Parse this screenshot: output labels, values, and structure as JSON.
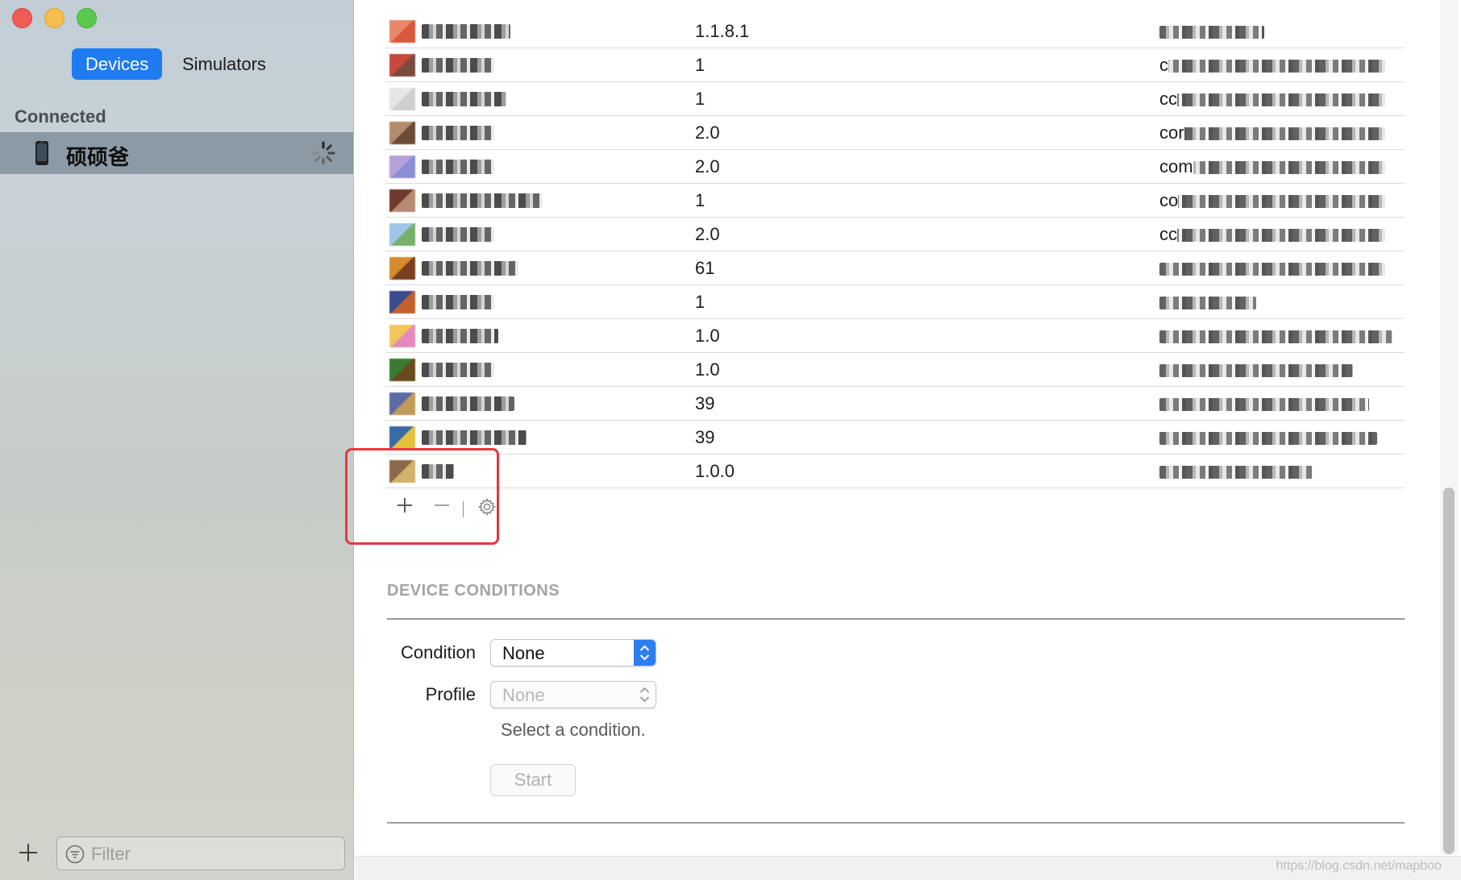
{
  "window": {
    "traffic_lights": {
      "close": "#ee5c55",
      "minimize": "#f6be4f",
      "zoom": "#5bc94d"
    }
  },
  "sidebar": {
    "tabs": [
      {
        "label": "Devices",
        "selected": true
      },
      {
        "label": "Simulators",
        "selected": false
      }
    ],
    "section_header": "Connected",
    "device": {
      "name": "硕硕爸",
      "icon": "iphone-icon",
      "status_icon": "loading-spinner-icon"
    },
    "filter": {
      "placeholder": "Filter",
      "icon": "filter-icon"
    },
    "add_icon": "plus-icon"
  },
  "apps_table": {
    "rows": [
      {
        "version": "1.1.8.1",
        "id_prefix": "",
        "icon_colors": [
          "#e8866a",
          "#d9573b"
        ]
      },
      {
        "version": "1",
        "id_prefix": "c",
        "icon_colors": [
          "#c7493b",
          "#7a4c40"
        ]
      },
      {
        "version": "1",
        "id_prefix": "cc",
        "icon_colors": [
          "#e6e6e6",
          "#cfcfcf"
        ]
      },
      {
        "version": "2.0",
        "id_prefix": "cor",
        "icon_colors": [
          "#b48c6e",
          "#6b4a36"
        ]
      },
      {
        "version": "2.0",
        "id_prefix": "com",
        "icon_colors": [
          "#b6a2d6",
          "#8d8fd6"
        ]
      },
      {
        "version": "1",
        "id_prefix": "co",
        "icon_colors": [
          "#6e3a2e",
          "#b88a76"
        ]
      },
      {
        "version": "2.0",
        "id_prefix": "cc",
        "icon_colors": [
          "#9ec4e6",
          "#76b16a"
        ]
      },
      {
        "version": "61",
        "id_prefix": "",
        "icon_colors": [
          "#d68a2e",
          "#7a3f1e"
        ]
      },
      {
        "version": "1",
        "id_prefix": "",
        "icon_colors": [
          "#3a4c8e",
          "#c2612e"
        ]
      },
      {
        "version": "1.0",
        "id_prefix": "",
        "icon_colors": [
          "#f2c65a",
          "#e58abf"
        ]
      },
      {
        "version": "1.0",
        "id_prefix": "",
        "icon_colors": [
          "#3a7a2e",
          "#6a4a1e"
        ]
      },
      {
        "version": "39",
        "id_prefix": "",
        "icon_colors": [
          "#5e6aa6",
          "#c29a5a"
        ]
      },
      {
        "version": "39",
        "id_prefix": "",
        "icon_colors": [
          "#3a6aa6",
          "#e2c23a"
        ]
      },
      {
        "version": "1.0.0",
        "id_prefix": "",
        "icon_colors": [
          "#8a6a4a",
          "#d2b26a"
        ]
      }
    ],
    "toolbar": {
      "add_icon": "plus-icon",
      "remove_icon": "minus-icon",
      "settings_icon": "gear-icon"
    }
  },
  "device_conditions": {
    "title": "DEVICE CONDITIONS",
    "condition_label": "Condition",
    "condition_value": "None",
    "profile_label": "Profile",
    "profile_value": "None",
    "hint": "Select a condition.",
    "start_label": "Start"
  },
  "watermark": "https://blog.csdn.net/mapboo",
  "colors": {
    "accent": "#1f7bf2",
    "highlight_border": "#e8373f"
  }
}
